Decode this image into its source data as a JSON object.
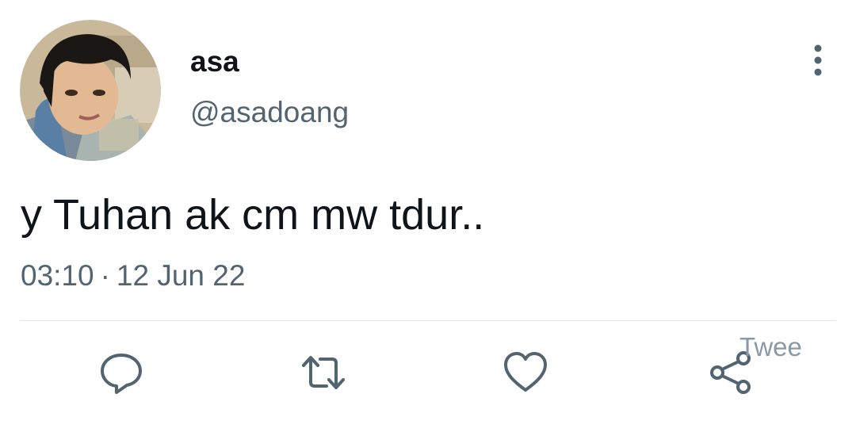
{
  "author": {
    "display_name": "asa",
    "handle": "@asadoang",
    "avatar": "avatar-photo"
  },
  "tweet": {
    "text": "y Tuhan ak cm mw tdur..",
    "time": "03:10",
    "separator": "·",
    "date": "12 Jun 22"
  },
  "actions": {
    "reply_icon": "reply-icon",
    "retweet_icon": "retweet-icon",
    "like_icon": "heart-icon",
    "share_icon": "share-icon",
    "share_label": "Twee"
  },
  "more_icon": "more-vertical-icon",
  "colors": {
    "text": "#0f1419",
    "secondary": "#536471",
    "icon": "#536471",
    "divider": "#e1e6ea"
  }
}
